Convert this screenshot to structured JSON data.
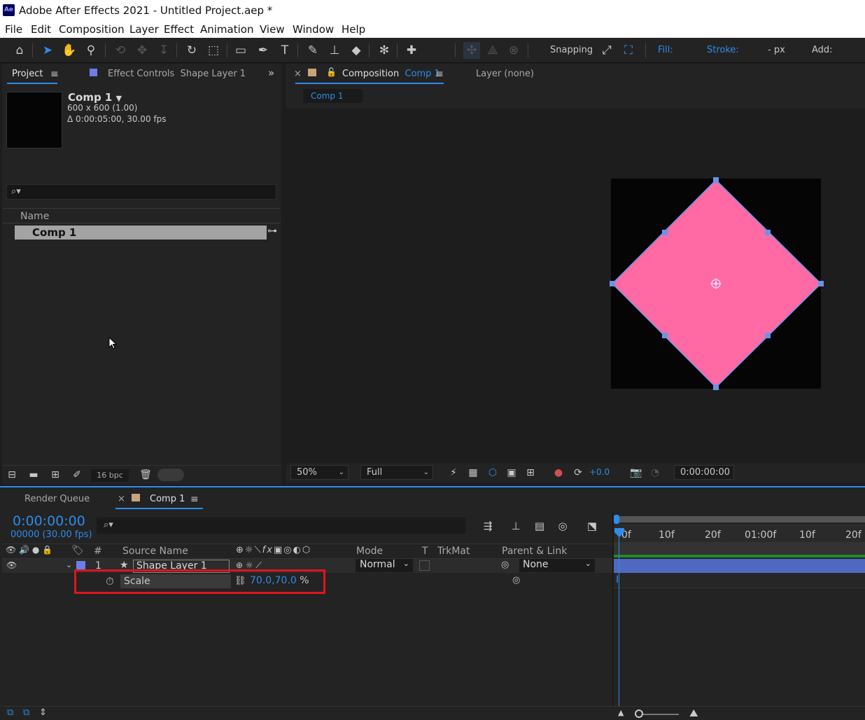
{
  "window": {
    "app_icon": "Ae",
    "title": "Adobe After Effects 2021 - Untitled Project.aep *"
  },
  "menu": [
    "File",
    "Edit",
    "Composition",
    "Layer",
    "Effect",
    "Animation",
    "View",
    "Window",
    "Help"
  ],
  "toolbar": {
    "snapping_label": "Snapping",
    "fill_label": "Fill:",
    "stroke_label": "Stroke:",
    "stroke_width": "- px",
    "add_label": "Add:",
    "fill_color": "#ff6aa5"
  },
  "project_panel": {
    "tab_project": "Project",
    "tab_effect_controls": "Effect Controls",
    "tab_effect_controls_layer": "Shape Layer 1",
    "comp_name": "Comp 1",
    "comp_dims": "600 x 600 (1.00)",
    "comp_duration": "Δ 0:00:05:00, 30.00 fps",
    "search_icon": "⌕▾",
    "column_name": "Name",
    "items": [
      {
        "name": "Comp 1"
      }
    ],
    "bit_depth": "16 bpc"
  },
  "composition_panel": {
    "tab_prefix": "Composition",
    "tab_comp": "Comp 1",
    "layer_tab": "Layer (none)",
    "breadcrumb": "Comp 1",
    "zoom": "50%",
    "resolution": "Full",
    "exposure": "+0.0",
    "timecode": "0:00:00:00",
    "shape_color": "#ff6aa5"
  },
  "timeline": {
    "tab_render_queue": "Render Queue",
    "tab_comp": "Comp 1",
    "current_time": "0:00:00:00",
    "frame_info": "00000 (30.00 fps)",
    "columns": {
      "hash": "#",
      "source_name": "Source Name",
      "mode": "Mode",
      "t": "T",
      "trkmat": "TrkMat",
      "parent_link": "Parent & Link"
    },
    "layers": [
      {
        "number": "1",
        "name": "Shape Layer 1",
        "mode": "Normal",
        "parent": "None"
      }
    ],
    "property": {
      "name": "Scale",
      "value_x": "70.0",
      "separator": ",",
      "value_y": "70.0",
      "unit": "%"
    },
    "ruler_labels": [
      "0f",
      "10f",
      "20f",
      "01:00f",
      "10f",
      "20f"
    ]
  }
}
